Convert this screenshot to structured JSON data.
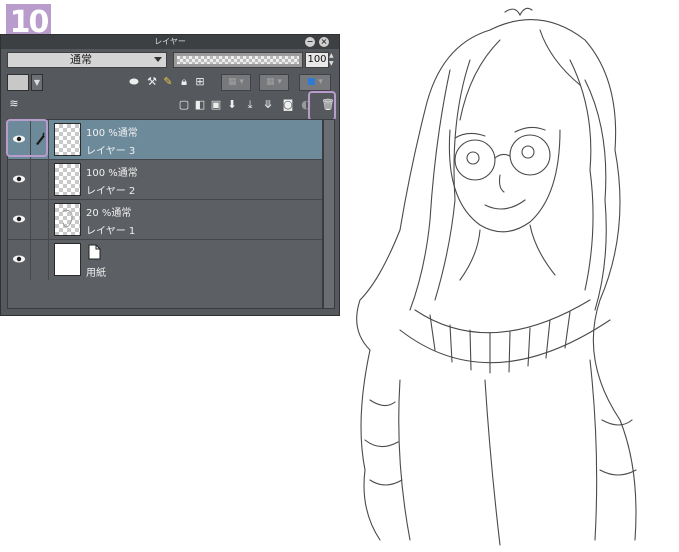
{
  "step_badge": "10",
  "panel": {
    "title": "レイヤー",
    "blend_mode": "通常",
    "opacity_value": "100"
  },
  "layers": [
    {
      "line1": "100 %通常",
      "line2": "レイヤー 3",
      "selected": true
    },
    {
      "line1": "100 %通常",
      "line2": "レイヤー 2",
      "selected": false
    },
    {
      "line1": "20 %通常",
      "line2": "レイヤー 1",
      "selected": false
    },
    {
      "line1": "",
      "line2": "用紙",
      "selected": false
    }
  ],
  "colors": {
    "highlight": "#b79ccc",
    "selected_layer": "#6d8a9b",
    "panel_bg": "#55585c"
  },
  "icons": [
    "eye-icon",
    "pen-icon",
    "trash-icon",
    "new-layer-icon",
    "lock-icon",
    "page-icon"
  ]
}
